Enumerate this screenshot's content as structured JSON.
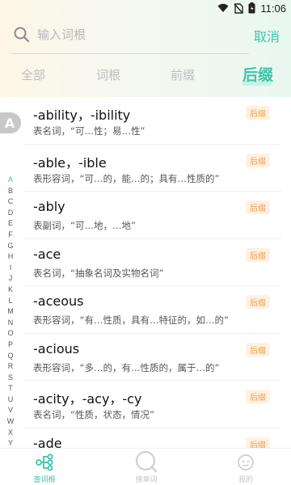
{
  "status_bar": {
    "time": "11:06"
  },
  "search": {
    "placeholder": "输入词根",
    "cancel_label": "取消"
  },
  "tabs": [
    {
      "label": "全部"
    },
    {
      "label": "词根"
    },
    {
      "label": "前缀"
    },
    {
      "label": "后缀",
      "active": true
    }
  ],
  "current_letter": "A",
  "alphabet": [
    "A",
    "B",
    "C",
    "D",
    "E",
    "F",
    "G",
    "H",
    "I",
    "J",
    "K",
    "L",
    "M",
    "N",
    "O",
    "P",
    "Q",
    "R",
    "S",
    "T",
    "U",
    "V",
    "W",
    "X",
    "Y"
  ],
  "items": [
    {
      "title": "-ability，-ibility",
      "desc": "表名词，“可…性；易…性”",
      "tag": "后缀"
    },
    {
      "title": "-able，-ible",
      "desc": "表形容词，“可…的，能…的；具有…性质的”",
      "tag": "后缀"
    },
    {
      "title": "-ably",
      "desc": "表副词，“可…地，…地”",
      "tag": "后缀"
    },
    {
      "title": "-ace",
      "desc": "表名词，“抽象名词及实物名词”",
      "tag": "后缀"
    },
    {
      "title": "-aceous",
      "desc": "表形容词，“有…性质，具有…特征的，如…的”",
      "tag": "后缀"
    },
    {
      "title": "-acious",
      "desc": "表形容词，“多…的，有…性质的，属于…的”",
      "tag": "后缀"
    },
    {
      "title": "-acity，-acy，-cy",
      "desc": "表名词，“性质，状态，情况”",
      "tag": "后缀"
    },
    {
      "title": "-ade",
      "desc": "",
      "tag": "后缀"
    }
  ],
  "bottom_nav": [
    {
      "label": "查词根",
      "icon": "tree-icon",
      "active": true
    },
    {
      "label": "搜单词",
      "icon": "search-icon",
      "active": false
    },
    {
      "label": "我的",
      "icon": "face-icon",
      "active": false
    }
  ],
  "colors": {
    "accent": "#3dc4a8",
    "tag": "#e9a04c",
    "tag_bg": "#fff1e2"
  }
}
